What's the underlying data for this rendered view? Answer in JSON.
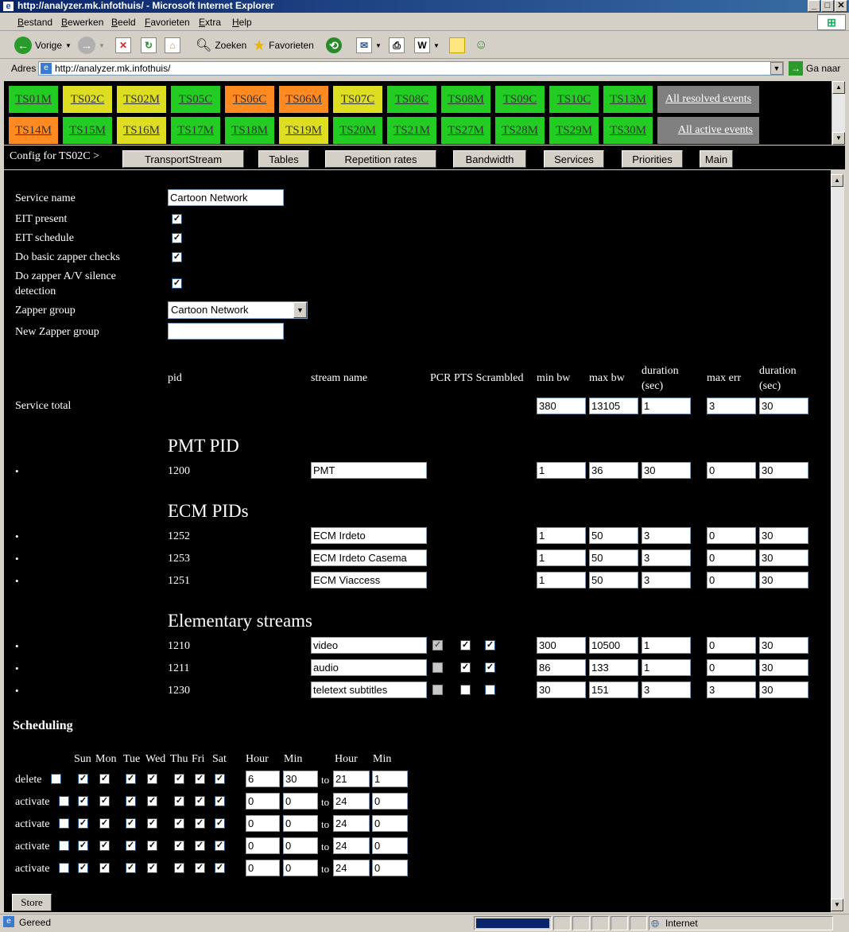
{
  "window": {
    "title": "http://analyzer.mk.infothuis/ - Microsoft Internet Explorer"
  },
  "menu": [
    "Bestand",
    "Bewerken",
    "Beeld",
    "Favorieten",
    "Extra",
    "Help"
  ],
  "toolbar": {
    "back": "Vorige",
    "search": "Zoeken",
    "favorites": "Favorieten"
  },
  "address": {
    "label": "Adres",
    "url": "http://analyzer.mk.infothuis/",
    "go": "Ga naar"
  },
  "ts_buttons": [
    {
      "label": "TS01M",
      "color": "#22cc22"
    },
    {
      "label": "TS02C",
      "color": "#dddd22"
    },
    {
      "label": "TS02M",
      "color": "#dddd22"
    },
    {
      "label": "TS05C",
      "color": "#22cc22"
    },
    {
      "label": "TS06C",
      "color": "#ff8a22"
    },
    {
      "label": "TS06M",
      "color": "#ff8a22"
    },
    {
      "label": "TS07C",
      "color": "#dddd22"
    },
    {
      "label": "TS08C",
      "color": "#22cc22"
    },
    {
      "label": "TS08M",
      "color": "#22cc22"
    },
    {
      "label": "TS09C",
      "color": "#22cc22"
    },
    {
      "label": "TS10C",
      "color": "#22cc22"
    },
    {
      "label": "TS13M",
      "color": "#22cc22"
    },
    {
      "label": "TS14M",
      "color": "#ff8a22"
    },
    {
      "label": "TS15M",
      "color": "#22cc22"
    },
    {
      "label": "TS16M",
      "color": "#dddd22"
    },
    {
      "label": "TS17M",
      "color": "#22cc22"
    },
    {
      "label": "TS18M",
      "color": "#22cc22"
    },
    {
      "label": "TS19M",
      "color": "#dddd22"
    },
    {
      "label": "TS20M",
      "color": "#22cc22"
    },
    {
      "label": "TS21M",
      "color": "#22cc22"
    },
    {
      "label": "TS27M",
      "color": "#22cc22"
    },
    {
      "label": "TS28M",
      "color": "#22cc22"
    },
    {
      "label": "TS29M",
      "color": "#22cc22"
    },
    {
      "label": "TS30M",
      "color": "#22cc22"
    }
  ],
  "events": {
    "resolved": "All resolved events",
    "active": "All active events"
  },
  "config": {
    "label": "Config for TS02C >",
    "buttons": [
      "TransportStream",
      "Tables",
      "Repetition rates",
      "Bandwidth",
      "Services",
      "Priorities",
      "Main"
    ]
  },
  "service": {
    "name_label": "Service name",
    "name_value": "Cartoon Network",
    "eit_present": "EIT present",
    "eit_schedule": "EIT schedule",
    "zapper_checks": "Do basic zapper checks",
    "zapper_av_line1": "Do zapper A/V silence",
    "zapper_av_line2": "detection",
    "zapper_group_label": "Zapper group",
    "zapper_group_value": "Cartoon Network",
    "new_zapper_label": "New Zapper group"
  },
  "table_headers": {
    "pid": "pid",
    "stream_name": "stream name",
    "flags": "PCR PTS Scrambled",
    "min_bw": "min bw",
    "max_bw": "max bw",
    "duration_1": "duration",
    "duration_2": "(sec)",
    "max_err": "max err"
  },
  "service_total": {
    "label": "Service total",
    "min_bw": "380",
    "max_bw": "13105",
    "duration": "1",
    "max_err": "3",
    "duration2": "30"
  },
  "sections": {
    "pmt": "PMT PID",
    "ecm": "ECM PIDs",
    "es": "Elementary streams"
  },
  "bullet": "•",
  "pmt_row": {
    "pid": "1200",
    "name": "PMT",
    "min_bw": "1",
    "max_bw": "36",
    "duration": "30",
    "max_err": "0",
    "duration2": "30"
  },
  "ecm_rows": [
    {
      "pid": "1252",
      "name": "ECM Irdeto",
      "min_bw": "1",
      "max_bw": "50",
      "duration": "3",
      "max_err": "0",
      "duration2": "30"
    },
    {
      "pid": "1253",
      "name": "ECM Irdeto Casema",
      "min_bw": "1",
      "max_bw": "50",
      "duration": "3",
      "max_err": "0",
      "duration2": "30"
    },
    {
      "pid": "1251",
      "name": "ECM Viaccess",
      "min_bw": "1",
      "max_bw": "50",
      "duration": "3",
      "max_err": "0",
      "duration2": "30"
    }
  ],
  "es_rows": [
    {
      "pid": "1210",
      "name": "video",
      "min_bw": "300",
      "max_bw": "10500",
      "duration": "1",
      "max_err": "0",
      "duration2": "30"
    },
    {
      "pid": "1211",
      "name": "audio",
      "min_bw": "86",
      "max_bw": "133",
      "duration": "1",
      "max_err": "0",
      "duration2": "30"
    },
    {
      "pid": "1230",
      "name": "teletext subtitles",
      "min_bw": "30",
      "max_bw": "151",
      "duration": "3",
      "max_err": "3",
      "duration2": "30"
    }
  ],
  "scheduling": {
    "title": "Scheduling",
    "days": [
      "Sun",
      "Mon",
      "Tue",
      "Wed",
      "Thu",
      "Fri",
      "Sat"
    ],
    "hour": "Hour",
    "min": "Min",
    "to": "to",
    "rows": [
      {
        "action": "delete",
        "h1": "6",
        "m1": "30",
        "h2": "21",
        "m2": "1"
      },
      {
        "action": "activate",
        "h1": "0",
        "m1": "0",
        "h2": "24",
        "m2": "0"
      },
      {
        "action": "activate",
        "h1": "0",
        "m1": "0",
        "h2": "24",
        "m2": "0"
      },
      {
        "action": "activate",
        "h1": "0",
        "m1": "0",
        "h2": "24",
        "m2": "0"
      },
      {
        "action": "activate",
        "h1": "0",
        "m1": "0",
        "h2": "24",
        "m2": "0"
      }
    ],
    "store": "Store"
  },
  "status": {
    "text": "Gereed",
    "zone": "Internet"
  }
}
